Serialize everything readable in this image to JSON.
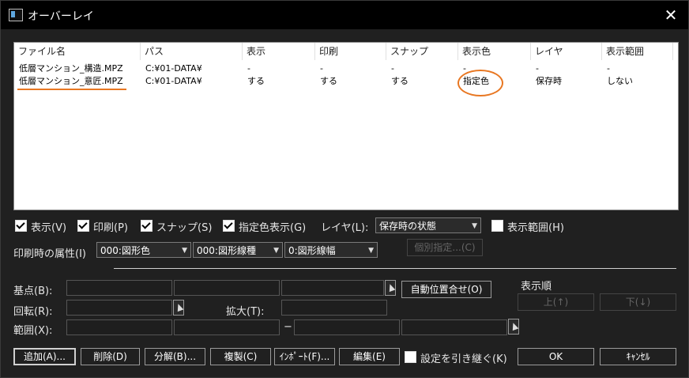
{
  "window": {
    "title": "オーバーレイ"
  },
  "list": {
    "columns": [
      "ファイル名",
      "パス",
      "表示",
      "印刷",
      "スナップ",
      "表示色",
      "レイヤ",
      "表示範囲"
    ],
    "rows": [
      [
        "低層マンション_構造.MPZ",
        "C:¥01-DATA¥",
        "-",
        "-",
        "-",
        "-",
        "-",
        "-"
      ],
      [
        "低層マンション_意匠.MPZ",
        "C:¥01-DATA¥",
        "する",
        "する",
        "する",
        "指定色",
        "保存時",
        "しない"
      ]
    ]
  },
  "options": {
    "display": "表示(V)",
    "print": "印刷(P)",
    "snap": "スナップ(S)",
    "color_display": "指定色表示(G)",
    "layer_label": "レイヤ(L):",
    "layer_value": "保存時の状態",
    "display_range": "表示範囲(H)"
  },
  "print_attr": {
    "label": "印刷時の属性(I)",
    "color": "000:図形色",
    "linetype": "000:図形線種",
    "linewidth": "0:図形線幅",
    "individual_button": "個別指定...(C)"
  },
  "position": {
    "base_label": "基点(B):",
    "auto_button": "自動位置合せ(O)",
    "rotate_label": "回転(R):",
    "scale_label": "拡大(T):",
    "range_label": "範囲(X):",
    "range_dash": "−",
    "order_label": "表示順",
    "up_button": "上(↑)",
    "down_button": "下(↓)"
  },
  "footer": {
    "add": "追加(A)...",
    "delete": "削除(D)",
    "split": "分解(B)...",
    "copy": "複製(C)",
    "import": "ｲﾝﾎﾟｰﾄ(F)...",
    "edit": "編集(E)",
    "inherit_label": "設定を引き継ぐ(K)",
    "ok": "OK",
    "cancel": "ｷｬﾝｾﾙ"
  },
  "colors": {
    "accent": "#e87722"
  }
}
